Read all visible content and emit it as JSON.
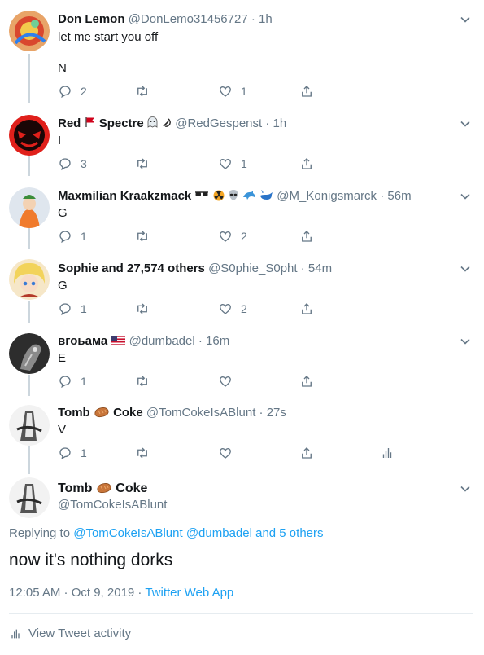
{
  "colors": {
    "accent": "#1da1f2",
    "secondary_text": "#657786",
    "thread_line": "#ccd6dd"
  },
  "tweets": [
    {
      "name": "Don Lemon",
      "handle": "@DonLemo31456727",
      "time": "· 1h",
      "text": "let me start you off",
      "text2": "N",
      "replies": "2",
      "retweets": "",
      "likes": "1"
    },
    {
      "name": "Red",
      "name2": "Spectre",
      "handle": "@RedGespenst",
      "time": "· 1h",
      "text": "I",
      "replies": "3",
      "retweets": "",
      "likes": "1"
    },
    {
      "name": "Maxmilian Kraakzmack",
      "handle": "@M_Konigsmarck",
      "time": "· 56m",
      "text": "G",
      "replies": "1",
      "retweets": "",
      "likes": "2"
    },
    {
      "name": "Sophie and 27,574 others",
      "handle": "@S0phie_S0pht",
      "time": "· 54m",
      "text": "G",
      "replies": "1",
      "retweets": "",
      "likes": "2"
    },
    {
      "name": "ʙгоьама",
      "handle": "@dumbadel",
      "time": "· 16m",
      "text": "E",
      "replies": "1",
      "retweets": "",
      "likes": ""
    },
    {
      "name": "Tomb",
      "name2": "Coke",
      "handle": "@TomCokeIsABlunt",
      "time": "· 27s",
      "text": "V",
      "replies": "1",
      "retweets": "",
      "likes": ""
    }
  ],
  "main_tweet": {
    "name": "Tomb",
    "name2": "Coke",
    "handle": "@TomCokeIsABlunt",
    "replying_prefix": "Replying to",
    "replying_to": "@TomCokeIsABlunt @dumbadel and 5 others",
    "text": "now it's nothing dorks",
    "timestamp": "12:05 AM · Oct 9, 2019 · ",
    "app": "Twitter Web App",
    "activity_label": "View Tweet activity"
  }
}
